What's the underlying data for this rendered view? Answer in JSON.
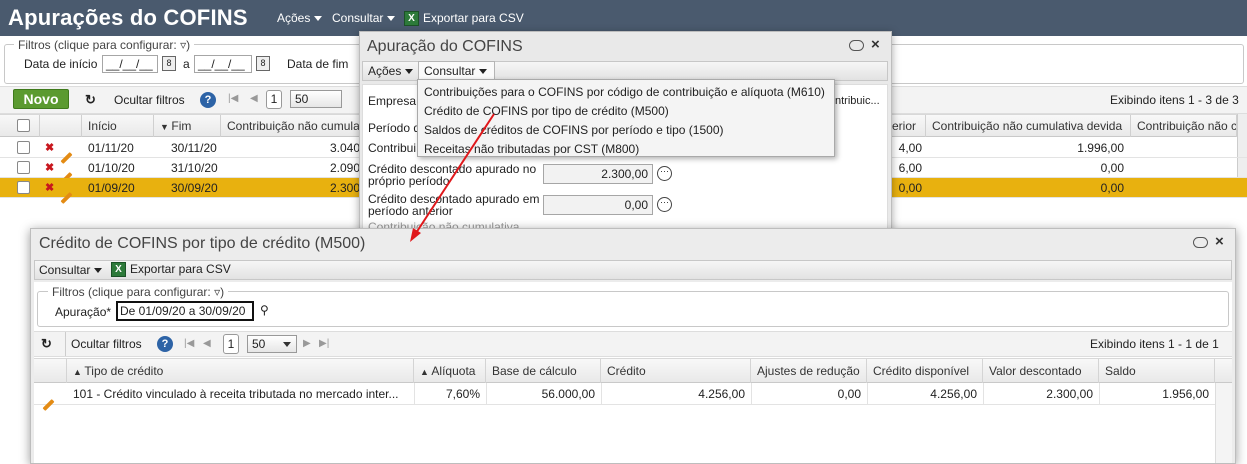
{
  "app": {
    "title": "Apurações do COFINS",
    "menu": {
      "acoes": "Ações",
      "consultar": "Consultar",
      "exportar": "Exportar para CSV"
    }
  },
  "bg_filters": {
    "title": "Filtros (clique para configurar:",
    "data_inicio_label": "Data de início",
    "data_inicio_value": "__/__/__",
    "a_label": "a",
    "data_inicio_to_value": "__/__/__",
    "data_fim_label": "Data de fim"
  },
  "bg_toolbar": {
    "novo": "Novo",
    "ocultar_filtros": "Ocultar filtros",
    "page": "1",
    "page_size": "50",
    "exibindo": "Exibindo itens 1 - 3 de 3"
  },
  "bg_grid": {
    "headers": {
      "inicio": "Início",
      "fim": "Fim",
      "contrib_nc": "Contribuição não cumulativa",
      "anterior": "erior",
      "contrib_nc_devida": "Contribuição não cumulativa devida",
      "contrib_nao": "Contribuição não c"
    },
    "rows": [
      {
        "inicio": "01/11/20",
        "fim": "30/11/20",
        "contrib": "3.040",
        "ant": "4,00",
        "devida": "1.996,00",
        "selected": false
      },
      {
        "inicio": "01/10/20",
        "fim": "31/10/20",
        "contrib": "2.090",
        "ant": "6,00",
        "devida": "0,00",
        "selected": false
      },
      {
        "inicio": "01/09/20",
        "fim": "30/09/20",
        "contrib": "2.300",
        "ant": "0,00",
        "devida": "0,00",
        "selected": true
      }
    ]
  },
  "dialog_apuracao": {
    "title": "Apuração do COFINS",
    "menu": {
      "acoes": "Ações",
      "consultar": "Consultar"
    },
    "fields": {
      "empresa_label": "Empresa",
      "empresa_right": "ntribuic...",
      "periodo_label": "Período d",
      "contribuic_label": "Contribui",
      "credito_proprio_label": "Crédito descontado apurado no próprio período",
      "credito_proprio_value": "2.300,00",
      "credito_anterior_label": "Crédito descontado apurado em período anterior",
      "credito_anterior_value": "0,00",
      "contrib_nc_label": "Contribuição não cumulativa"
    }
  },
  "consultar_menu": {
    "items": [
      "Contribuições para o COFINS por código de contribuição e alíquota (M610)",
      "Crédito de COFINS por tipo de crédito (M500)",
      "Saldos de créditos de COFINS por período e tipo (1500)",
      "Receitas não tributadas por CST (M800)"
    ]
  },
  "dialog_credito": {
    "title": "Crédito de COFINS por tipo de crédito (M500)",
    "menu": {
      "consultar": "Consultar",
      "exportar": "Exportar para CSV"
    },
    "filters_title": "Filtros (clique para configurar:",
    "apuracao_label": "Apuração*",
    "apuracao_value": "De 01/09/20 a 30/09/20",
    "ocultar_filtros": "Ocultar filtros",
    "page": "1",
    "page_size": "50",
    "exibindo": "Exibindo itens 1 - 1 de 1",
    "headers": {
      "tipo": "Tipo de crédito",
      "aliquota": "Alíquota",
      "base": "Base de cálculo",
      "credito": "Crédito",
      "ajustes": "Ajustes de redução",
      "disponivel": "Crédito disponível",
      "descontado": "Valor descontado",
      "saldo": "Saldo"
    },
    "rows": [
      {
        "tipo": "101 - Crédito vinculado à receita tributada no mercado inter...",
        "aliquota": "7,60%",
        "base": "56.000,00",
        "credito": "4.256,00",
        "ajustes": "0,00",
        "disponivel": "4.256,00",
        "descontado": "2.300,00",
        "saldo": "1.956,00"
      }
    ]
  },
  "colors": {
    "topbar": "#4a5a6e",
    "selected_row": "#e8b10f",
    "novo_button": "#5b9a30",
    "arrow": "#e0181b"
  }
}
